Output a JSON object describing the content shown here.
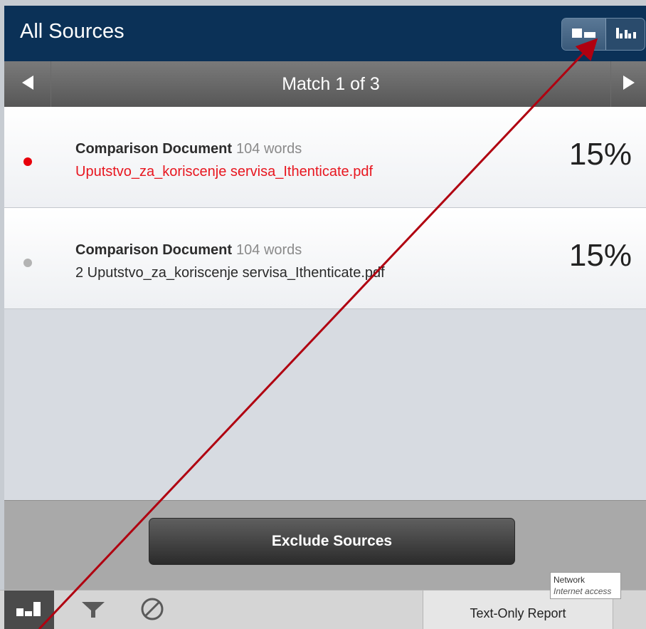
{
  "header": {
    "title": "All Sources"
  },
  "match_nav": {
    "label": "Match 1 of 3"
  },
  "sources": [
    {
      "title": "Comparison Document",
      "words": "104 words",
      "file": "Uputstvo_za_koriscenje servisa_Ithenticate.pdf",
      "percent": "15%",
      "selected": true
    },
    {
      "title": "Comparison Document",
      "words": "104 words",
      "file": "2 Uputstvo_za_koriscenje servisa_Ithenticate.pdf",
      "percent": "15%",
      "selected": false
    }
  ],
  "footer": {
    "exclude_label": "Exclude Sources"
  },
  "tooltip": {
    "title": "Network",
    "subtitle": "Internet access"
  },
  "bottom_bar": {
    "report_label": "Text-Only Report"
  },
  "colors": {
    "header_bg": "#0b3157",
    "selected_text": "#e8161f",
    "selected_dot": "#e8000b",
    "unselected_dot": "#b3b3b3",
    "annotation_arrow": "#b00010"
  },
  "icons": [
    "list-view-icon",
    "bar-chart-view-icon",
    "prev-arrow-icon",
    "next-arrow-icon",
    "chart-icon",
    "filter-icon",
    "exclude-icon"
  ]
}
